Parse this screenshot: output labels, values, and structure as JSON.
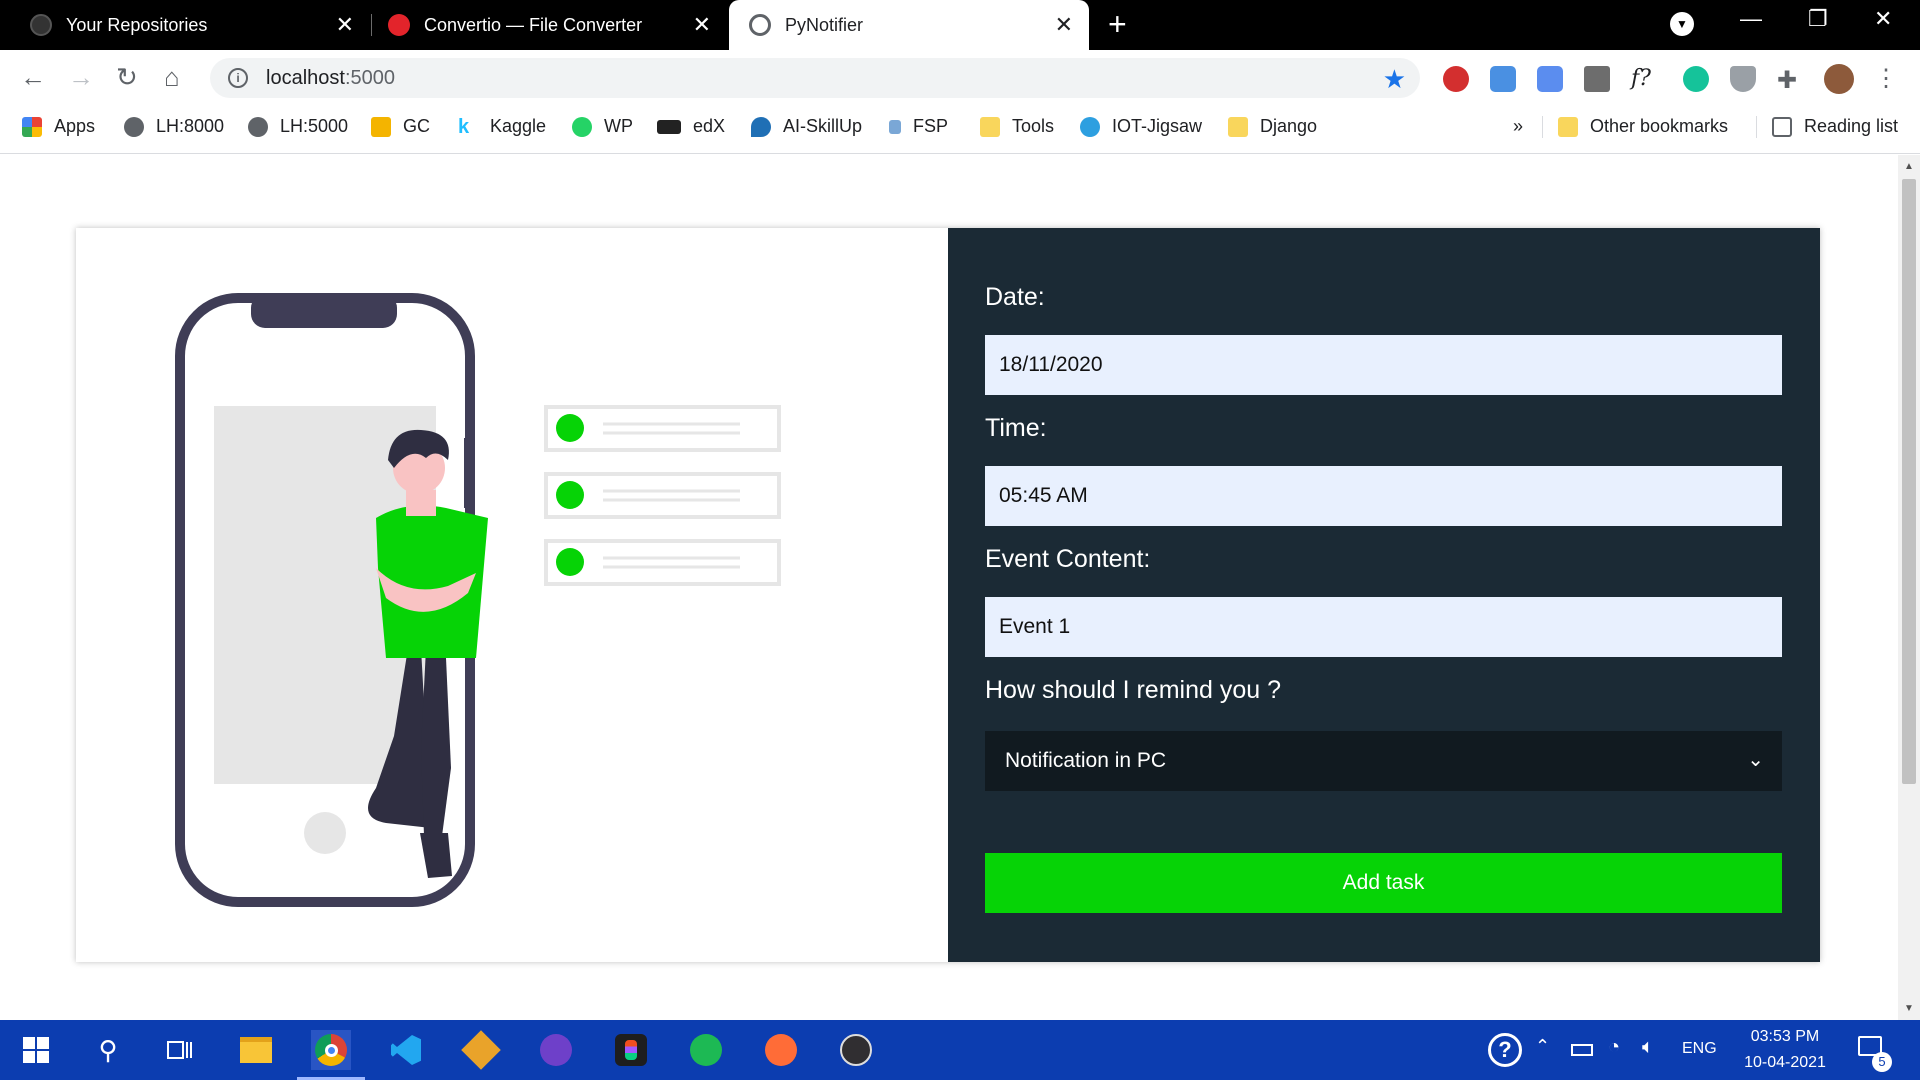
{
  "tabs": [
    {
      "title": "Your Repositories",
      "icon": "github-icon"
    },
    {
      "title": "Convertio — File Converter",
      "icon": "convertio-icon"
    },
    {
      "title": "PyNotifier",
      "icon": "globe-icon",
      "active": true
    }
  ],
  "address": {
    "host": "localhost",
    "port": ":5000"
  },
  "bookmarks": [
    {
      "label": "Apps",
      "icon": "apps-grid-icon"
    },
    {
      "label": "LH:8000",
      "icon": "globe-icon"
    },
    {
      "label": "LH:5000",
      "icon": "globe-icon"
    },
    {
      "label": "GC",
      "icon": "google-classroom-icon"
    },
    {
      "label": "Kaggle",
      "icon": "kaggle-icon"
    },
    {
      "label": "WP",
      "icon": "whatsapp-icon"
    },
    {
      "label": "edX",
      "icon": "edx-icon"
    },
    {
      "label": "AI-SkillUp",
      "icon": "rocket-icon"
    },
    {
      "label": "FSP",
      "icon": "fsp-icon"
    },
    {
      "label": "Tools",
      "icon": "folder-icon"
    },
    {
      "label": "IOT-Jigsaw",
      "icon": "jigsaw-icon"
    },
    {
      "label": "Django",
      "icon": "folder-icon"
    }
  ],
  "bookmarks_overflow": "»",
  "other_bookmarks": "Other bookmarks",
  "reading_list": "Reading list",
  "form": {
    "date_label": "Date:",
    "date_value": "18/11/2020",
    "time_label": "Time:",
    "time_value": "05:45 AM",
    "content_label": "Event Content:",
    "content_value": "Event 1",
    "remind_label": "How should I remind you ?",
    "remind_value": "Notification in PC",
    "submit_label": "Add task"
  },
  "taskbar": {
    "language": "ENG",
    "time": "03:53 PM",
    "date": "10-04-2021",
    "notification_count": "5"
  },
  "colors": {
    "form_panel": "#1b2a35",
    "input_bg": "#e8f0fe",
    "select_bg": "#111a20",
    "accent_green": "#06d306",
    "taskbar": "#0c3db0"
  }
}
